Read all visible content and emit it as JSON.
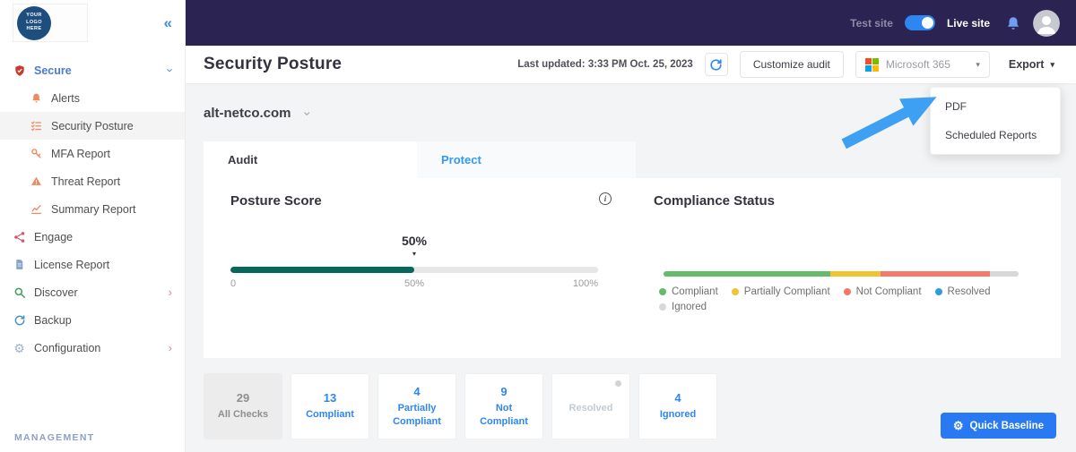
{
  "colors": {
    "topbar_bg": "#2b2452",
    "accent_blue": "#2e86f0",
    "posture_teal": "#07685a",
    "compliant_green": "#66bb6a",
    "partially_compliant_yellow": "#f2c230",
    "not_compliant_red": "#f4796b",
    "resolved_blue": "#2d9cdb",
    "ignored_gray": "#d8d8d8"
  },
  "topbar": {
    "test_site_label": "Test site",
    "live_site_label": "Live site"
  },
  "sidebar": {
    "logo_text": "YOUR LOGO HERE",
    "management_label": "MANAGEMENT",
    "items": [
      {
        "label": "Secure"
      },
      {
        "label": "Alerts"
      },
      {
        "label": "Security Posture"
      },
      {
        "label": "MFA Report"
      },
      {
        "label": "Threat Report"
      },
      {
        "label": "Summary Report"
      },
      {
        "label": "Engage"
      },
      {
        "label": "License Report"
      },
      {
        "label": "Discover"
      },
      {
        "label": "Backup"
      },
      {
        "label": "Configuration"
      }
    ]
  },
  "header": {
    "title": "Security Posture",
    "last_updated": "Last updated: 3:33 PM Oct. 25, 2023",
    "customize_button_label": "Customize audit",
    "tenant_selector_value": "Microsoft 365",
    "export_button_label": "Export"
  },
  "export_menu": {
    "items": [
      {
        "label": "PDF"
      },
      {
        "label": "Scheduled Reports"
      }
    ]
  },
  "main": {
    "domain_selector_value": "alt-netco.com",
    "tabs": [
      {
        "label": "Audit"
      },
      {
        "label": "Protect"
      }
    ],
    "posture": {
      "title": "Posture Score",
      "score_label": "50%",
      "score_value": 50,
      "scale_min": "0",
      "scale_mid": "50%",
      "scale_max": "100%"
    },
    "compliance": {
      "title": "Compliance Status",
      "segments": [
        {
          "name": "Compliant",
          "color": "#66bb6a",
          "percent": 47
        },
        {
          "name": "Partially Compliant",
          "color": "#f2c230",
          "percent": 14
        },
        {
          "name": "Not Compliant",
          "color": "#f4796b",
          "percent": 31
        },
        {
          "name": "Resolved",
          "color": "#2d9cdb",
          "percent": 0
        },
        {
          "name": "Ignored",
          "color": "#d8d8d8",
          "percent": 8
        }
      ]
    },
    "stats": [
      {
        "value": "29",
        "label": "All Checks"
      },
      {
        "value": "13",
        "label": "Compliant"
      },
      {
        "value": "4",
        "label": "Partially Compliant"
      },
      {
        "value": "9",
        "label": "Not Compliant"
      },
      {
        "value": "",
        "label": "Resolved"
      },
      {
        "value": "4",
        "label": "Ignored"
      }
    ],
    "quick_baseline_label": "Quick Baseline"
  }
}
